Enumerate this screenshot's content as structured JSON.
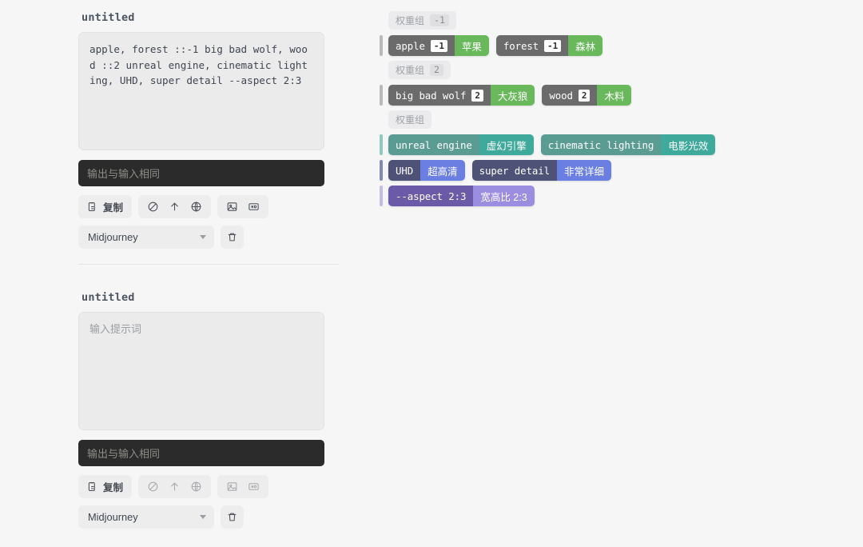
{
  "cards": [
    {
      "title": "untitled",
      "prompt_value": "apple, forest ::-1 big bad wolf, wood ::2 unreal engine, cinematic lighting, UHD, super detail --aspect 2:3",
      "prompt_placeholder": "输入提示词",
      "output_text": "输出与输入相同",
      "copy_label": "复制",
      "model": "Midjourney",
      "icons": {
        "copy": "clipboard-icon",
        "ban": "ban-icon",
        "up": "arrow-up-icon",
        "globe": "globe-icon",
        "image": "image-icon",
        "hd": "hd-icon",
        "trash": "trash-icon",
        "caret": "chevron-down-icon"
      }
    },
    {
      "title": "untitled",
      "prompt_value": "",
      "prompt_placeholder": "输入提示词",
      "output_text": "输出与输入相同",
      "copy_label": "复制",
      "model": "Midjourney",
      "icons": {
        "copy": "clipboard-icon",
        "ban": "ban-icon",
        "up": "arrow-up-icon",
        "globe": "globe-icon",
        "image": "image-icon",
        "hd": "hd-icon",
        "trash": "trash-icon",
        "caret": "chevron-down-icon"
      }
    }
  ],
  "weight_groups": [
    {
      "label": "权重组",
      "value": "-1",
      "rail_colors": [
        "#b9b9bb"
      ],
      "rows": [
        [
          {
            "theme": "th-gray",
            "text": "apple",
            "badge": "-1",
            "translation": "苹果"
          },
          {
            "theme": "th-gray",
            "text": "forest",
            "badge": "-1",
            "translation": "森林"
          }
        ]
      ]
    },
    {
      "label": "权重组",
      "value": "2",
      "rail_colors": [
        "#b9b9bb"
      ],
      "rows": [
        [
          {
            "theme": "th-gray",
            "text": "big bad wolf",
            "badge": "2",
            "translation": "大灰狼"
          },
          {
            "theme": "th-gray",
            "text": "wood",
            "badge": "2",
            "translation": "木料"
          }
        ]
      ]
    },
    {
      "label": "权重组",
      "value": "",
      "rail_colors": [
        "#8fc9c0",
        "#8089b8",
        "#c2bce8"
      ],
      "rows": [
        [
          {
            "theme": "th-teal",
            "text": "unreal engine",
            "badge": "",
            "translation": "虚幻引擎"
          },
          {
            "theme": "th-teal",
            "text": "cinematic lighting",
            "badge": "",
            "translation": "电影光效"
          }
        ],
        [
          {
            "theme": "th-indigo",
            "text": "UHD",
            "badge": "",
            "translation": "超高清"
          },
          {
            "theme": "th-indigo",
            "text": "super detail",
            "badge": "",
            "translation": "非常详细"
          }
        ],
        [
          {
            "theme": "th-purple",
            "text": "--aspect 2:3",
            "badge": "",
            "translation": "宽高比 2:3"
          }
        ]
      ]
    }
  ],
  "colors": {
    "background": "#f6f6f7",
    "output_bar": "#2b2b2b",
    "green_accent": "#69b95c",
    "teal_accent": "#3fa99b",
    "indigo_accent": "#6b7fe3",
    "purple_accent": "#9b8de0"
  }
}
